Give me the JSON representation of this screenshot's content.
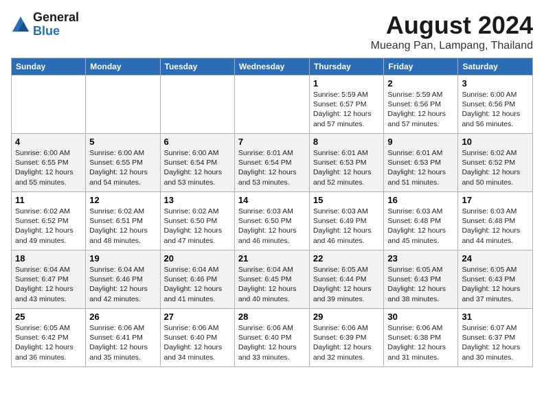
{
  "logo": {
    "line1": "General",
    "line2": "Blue"
  },
  "title": "August 2024",
  "location": "Mueang Pan, Lampang, Thailand",
  "days_of_week": [
    "Sunday",
    "Monday",
    "Tuesday",
    "Wednesday",
    "Thursday",
    "Friday",
    "Saturday"
  ],
  "weeks": [
    [
      {
        "day": "",
        "content": ""
      },
      {
        "day": "",
        "content": ""
      },
      {
        "day": "",
        "content": ""
      },
      {
        "day": "",
        "content": ""
      },
      {
        "day": "1",
        "content": "Sunrise: 5:59 AM\nSunset: 6:57 PM\nDaylight: 12 hours\nand 57 minutes."
      },
      {
        "day": "2",
        "content": "Sunrise: 5:59 AM\nSunset: 6:56 PM\nDaylight: 12 hours\nand 57 minutes."
      },
      {
        "day": "3",
        "content": "Sunrise: 6:00 AM\nSunset: 6:56 PM\nDaylight: 12 hours\nand 56 minutes."
      }
    ],
    [
      {
        "day": "4",
        "content": "Sunrise: 6:00 AM\nSunset: 6:55 PM\nDaylight: 12 hours\nand 55 minutes."
      },
      {
        "day": "5",
        "content": "Sunrise: 6:00 AM\nSunset: 6:55 PM\nDaylight: 12 hours\nand 54 minutes."
      },
      {
        "day": "6",
        "content": "Sunrise: 6:00 AM\nSunset: 6:54 PM\nDaylight: 12 hours\nand 53 minutes."
      },
      {
        "day": "7",
        "content": "Sunrise: 6:01 AM\nSunset: 6:54 PM\nDaylight: 12 hours\nand 53 minutes."
      },
      {
        "day": "8",
        "content": "Sunrise: 6:01 AM\nSunset: 6:53 PM\nDaylight: 12 hours\nand 52 minutes."
      },
      {
        "day": "9",
        "content": "Sunrise: 6:01 AM\nSunset: 6:53 PM\nDaylight: 12 hours\nand 51 minutes."
      },
      {
        "day": "10",
        "content": "Sunrise: 6:02 AM\nSunset: 6:52 PM\nDaylight: 12 hours\nand 50 minutes."
      }
    ],
    [
      {
        "day": "11",
        "content": "Sunrise: 6:02 AM\nSunset: 6:52 PM\nDaylight: 12 hours\nand 49 minutes."
      },
      {
        "day": "12",
        "content": "Sunrise: 6:02 AM\nSunset: 6:51 PM\nDaylight: 12 hours\nand 48 minutes."
      },
      {
        "day": "13",
        "content": "Sunrise: 6:02 AM\nSunset: 6:50 PM\nDaylight: 12 hours\nand 47 minutes."
      },
      {
        "day": "14",
        "content": "Sunrise: 6:03 AM\nSunset: 6:50 PM\nDaylight: 12 hours\nand 46 minutes."
      },
      {
        "day": "15",
        "content": "Sunrise: 6:03 AM\nSunset: 6:49 PM\nDaylight: 12 hours\nand 46 minutes."
      },
      {
        "day": "16",
        "content": "Sunrise: 6:03 AM\nSunset: 6:48 PM\nDaylight: 12 hours\nand 45 minutes."
      },
      {
        "day": "17",
        "content": "Sunrise: 6:03 AM\nSunset: 6:48 PM\nDaylight: 12 hours\nand 44 minutes."
      }
    ],
    [
      {
        "day": "18",
        "content": "Sunrise: 6:04 AM\nSunset: 6:47 PM\nDaylight: 12 hours\nand 43 minutes."
      },
      {
        "day": "19",
        "content": "Sunrise: 6:04 AM\nSunset: 6:46 PM\nDaylight: 12 hours\nand 42 minutes."
      },
      {
        "day": "20",
        "content": "Sunrise: 6:04 AM\nSunset: 6:46 PM\nDaylight: 12 hours\nand 41 minutes."
      },
      {
        "day": "21",
        "content": "Sunrise: 6:04 AM\nSunset: 6:45 PM\nDaylight: 12 hours\nand 40 minutes."
      },
      {
        "day": "22",
        "content": "Sunrise: 6:05 AM\nSunset: 6:44 PM\nDaylight: 12 hours\nand 39 minutes."
      },
      {
        "day": "23",
        "content": "Sunrise: 6:05 AM\nSunset: 6:43 PM\nDaylight: 12 hours\nand 38 minutes."
      },
      {
        "day": "24",
        "content": "Sunrise: 6:05 AM\nSunset: 6:43 PM\nDaylight: 12 hours\nand 37 minutes."
      }
    ],
    [
      {
        "day": "25",
        "content": "Sunrise: 6:05 AM\nSunset: 6:42 PM\nDaylight: 12 hours\nand 36 minutes."
      },
      {
        "day": "26",
        "content": "Sunrise: 6:06 AM\nSunset: 6:41 PM\nDaylight: 12 hours\nand 35 minutes."
      },
      {
        "day": "27",
        "content": "Sunrise: 6:06 AM\nSunset: 6:40 PM\nDaylight: 12 hours\nand 34 minutes."
      },
      {
        "day": "28",
        "content": "Sunrise: 6:06 AM\nSunset: 6:40 PM\nDaylight: 12 hours\nand 33 minutes."
      },
      {
        "day": "29",
        "content": "Sunrise: 6:06 AM\nSunset: 6:39 PM\nDaylight: 12 hours\nand 32 minutes."
      },
      {
        "day": "30",
        "content": "Sunrise: 6:06 AM\nSunset: 6:38 PM\nDaylight: 12 hours\nand 31 minutes."
      },
      {
        "day": "31",
        "content": "Sunrise: 6:07 AM\nSunset: 6:37 PM\nDaylight: 12 hours\nand 30 minutes."
      }
    ]
  ]
}
